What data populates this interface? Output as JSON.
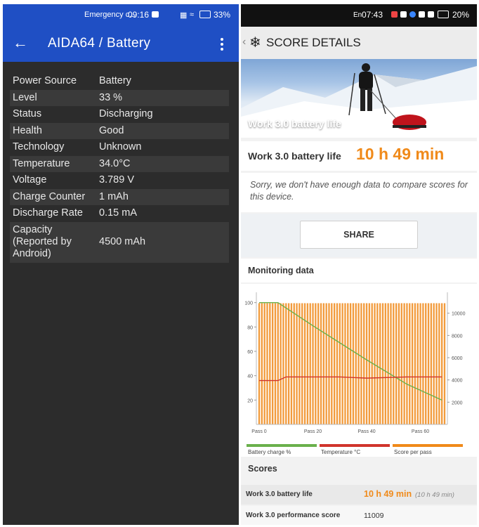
{
  "left": {
    "status": {
      "label": "Emergency c...",
      "time": "09:16",
      "battery_pct": "33%"
    },
    "appbar": {
      "title": "AIDA64  /  Battery"
    },
    "rows": [
      {
        "key": "Power Source",
        "value": "Battery"
      },
      {
        "key": "Level",
        "value": "33 %"
      },
      {
        "key": "Status",
        "value": "Discharging"
      },
      {
        "key": "Health",
        "value": "Good"
      },
      {
        "key": "Technology",
        "value": "Unknown"
      },
      {
        "key": "Temperature",
        "value": "34.0°C"
      },
      {
        "key": "Voltage",
        "value": "3.789 V"
      },
      {
        "key": "Charge Counter",
        "value": "1 mAh"
      },
      {
        "key": "Discharge Rate",
        "value": "0.15 mA"
      },
      {
        "key": "Capacity (Reported by Android)",
        "value": "4500 mAh"
      }
    ],
    "colors": {
      "appbar": "#1f4fc4",
      "background": "#2c2c2c"
    }
  },
  "right": {
    "status": {
      "carrier": "En",
      "time": "07:43",
      "battery_pct": "20%"
    },
    "header": {
      "title": "SCORE DETAILS"
    },
    "hero": {
      "label": "Work 3.0 battery life",
      "version": "3.0"
    },
    "result": {
      "label": "Work 3.0 battery life",
      "value": "10 h 49 min"
    },
    "note": "Sorry, we don't have enough data to compare scores for this device.",
    "share_label": "SHARE",
    "monitoring_title": "Monitoring data",
    "scores_title": "Scores",
    "scores": [
      {
        "name": "Work 3.0 battery life",
        "value": "10 h 49 min",
        "sub": "(10 h 49 min)"
      },
      {
        "name": "Work 3.0 performance score",
        "value": "11009"
      }
    ],
    "colors": {
      "accent": "#f08a1a",
      "battery": "#6ab04c",
      "temperature": "#d0342c",
      "score": "#f08a1a"
    }
  },
  "chart_data": {
    "type": "bar",
    "x_ticks": [
      "Pass 0",
      "Pass 20",
      "Pass 40",
      "Pass 60"
    ],
    "y_left_ticks": [
      "100",
      "80",
      "60",
      "40",
      "20"
    ],
    "y_right_ticks": [
      "10000",
      "8000",
      "6000",
      "4000",
      "2000"
    ],
    "ylim_left": [
      0,
      105
    ],
    "ylim_right": [
      0,
      11500
    ],
    "passes": 70,
    "legend": [
      "Battery charge %",
      "Temperature °C",
      "Score per pass"
    ],
    "series": [
      {
        "name": "Score per pass",
        "axis": "right",
        "kind": "bar",
        "typical": 10900
      },
      {
        "name": "Battery charge %",
        "axis": "left",
        "kind": "line",
        "x": [
          0,
          7,
          20,
          40,
          55,
          68
        ],
        "y": [
          100,
          100,
          81,
          53,
          33,
          20
        ]
      },
      {
        "name": "Temperature °C",
        "axis": "left",
        "kind": "line",
        "x": [
          0,
          7,
          10,
          20,
          30,
          40,
          55,
          68
        ],
        "y": [
          36,
          36,
          39,
          39,
          39,
          38,
          39,
          39
        ]
      }
    ]
  }
}
